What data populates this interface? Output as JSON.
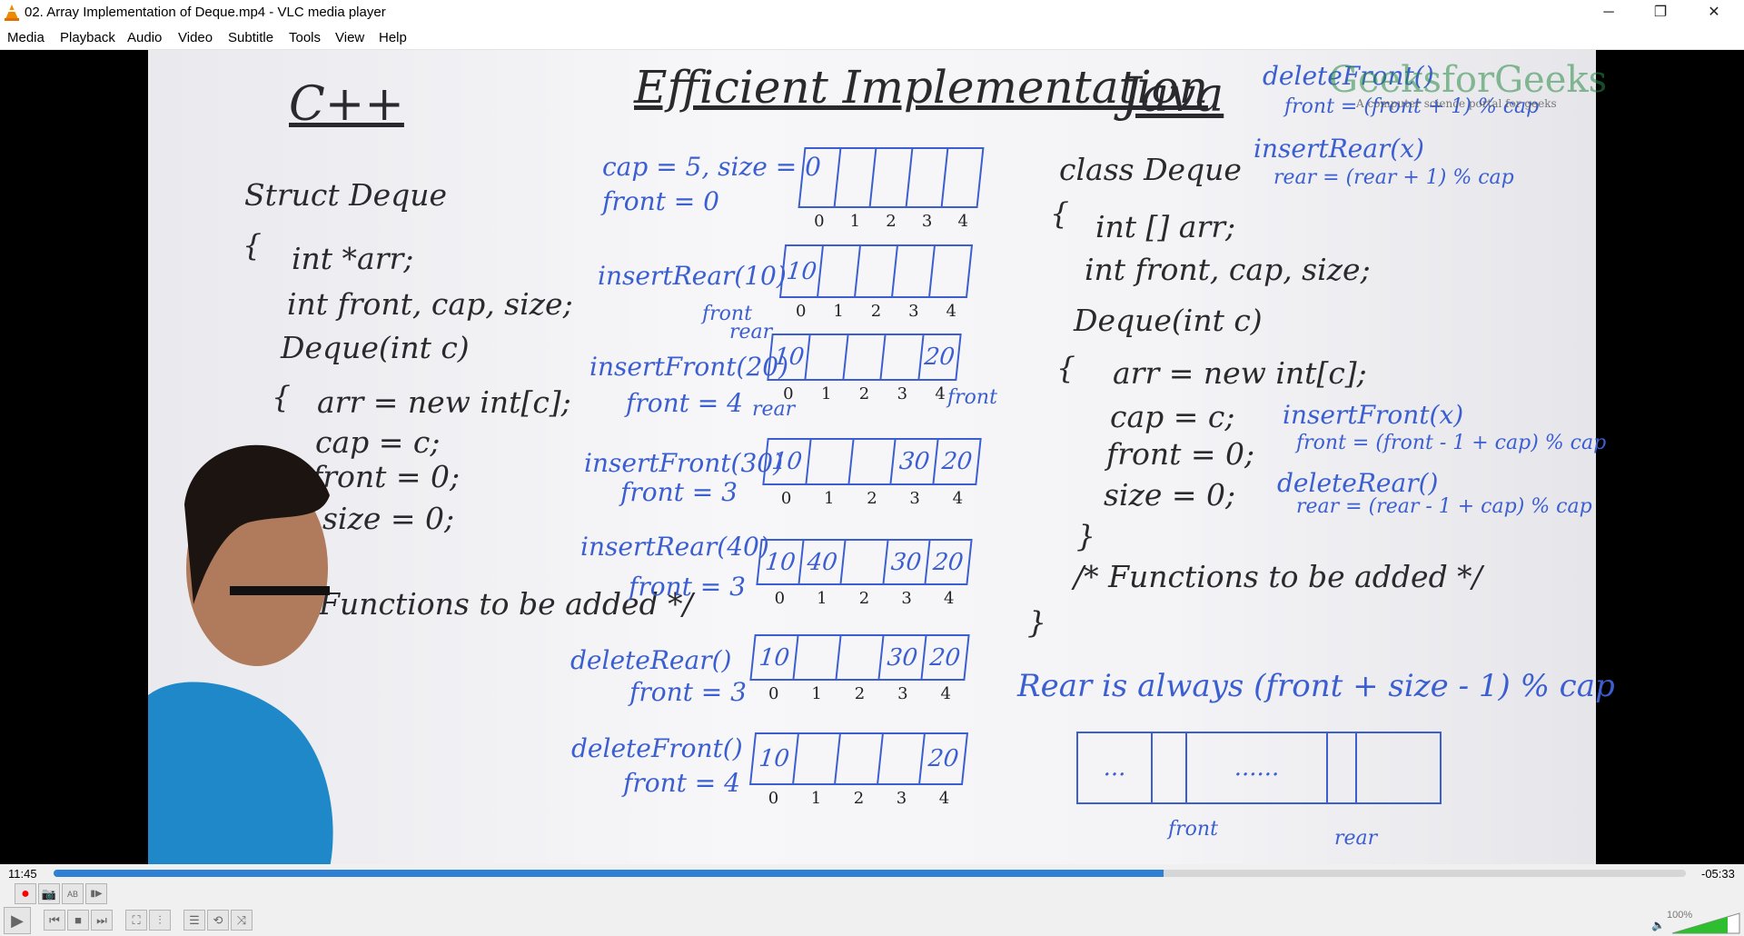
{
  "window": {
    "title": "02. Array Implementation of Deque.mp4 - VLC media player",
    "minimize": "─",
    "maximize": "❐",
    "close": "✕"
  },
  "menu": [
    "Media",
    "Playback",
    "Audio",
    "Video",
    "Subtitle",
    "Tools",
    "View",
    "Help"
  ],
  "board": {
    "cpp": {
      "heading": "C++",
      "lines": [
        "Struct Deque",
        "{",
        "int *arr;",
        "int front, cap, size;",
        "Deque(int c)",
        "{",
        "arr = new int[c];",
        "cap = c;",
        "front = 0;",
        "size = 0;",
        "/* Functions to be added */"
      ]
    },
    "center": {
      "heading": "Efficient Implementation",
      "init": [
        "cap = 5, size = 0",
        "front = 0"
      ],
      "steps": [
        {
          "label": "",
          "sub": "",
          "cells": [
            "",
            "",
            "",
            "",
            ""
          ]
        },
        {
          "label": "insertRear(10)",
          "sub": "",
          "cells": [
            "10",
            "",
            "",
            "",
            ""
          ],
          "notes": [
            "front",
            "rear"
          ]
        },
        {
          "label": "insertFront(20)",
          "sub": "front = 4",
          "cells": [
            "10",
            "",
            "",
            "",
            "20"
          ],
          "notes": [
            "rear",
            "front"
          ]
        },
        {
          "label": "insertFront(30)",
          "sub": "front = 3",
          "cells": [
            "10",
            "",
            "",
            "30",
            "20"
          ]
        },
        {
          "label": "insertRear(40)",
          "sub": "front = 3",
          "cells": [
            "10",
            "40",
            "",
            "30",
            "20"
          ]
        },
        {
          "label": "deleteRear()",
          "sub": "front = 3",
          "cells": [
            "10",
            "",
            "",
            "30",
            "20"
          ]
        },
        {
          "label": "deleteFront()",
          "sub": "front = 4",
          "cells": [
            "10",
            "",
            "",
            "",
            "20"
          ]
        }
      ],
      "indices": [
        "0",
        "1",
        "2",
        "3",
        "4"
      ]
    },
    "java": {
      "heading": "Java",
      "lines": [
        "class Deque",
        "{",
        "int [] arr;",
        "int front, cap, size;",
        "Deque(int c)",
        "{",
        "arr = new int[c];",
        "cap = c;",
        "front = 0;",
        "size = 0;",
        "}",
        "/* Functions to be added */",
        "}"
      ]
    },
    "notes": [
      "deleteFront()",
      "front = (front + 1) % cap",
      "insertRear(x)",
      "rear = (rear + 1) % cap",
      "insertFront(x)",
      "front = (front - 1 + cap) % cap",
      "deleteRear()",
      "rear = (rear - 1 + cap) % cap"
    ],
    "rear_formula": "Rear is always (front + size - 1) % cap",
    "diagram": {
      "cells": [
        "...",
        "",
        "......",
        "",
        ""
      ],
      "front": "front",
      "rear": "rear"
    },
    "watermark": {
      "brand": "GeeksforGeeks",
      "tagline": "A computer science portal for geeks"
    }
  },
  "player": {
    "elapsed": "11:45",
    "remaining": "-05:33",
    "progress": 0.68,
    "volume_label": "100%",
    "volume": 1.0,
    "accent": "#2f7fd4",
    "buttons": {
      "record": "●",
      "snapshot": "📷",
      "loop_ab": "AB",
      "frame": "▮▶",
      "play": "▶",
      "prev": "⏮",
      "stop": "■",
      "next": "⏭",
      "fullscreen": "⛶",
      "extended": "⫶",
      "playlist": "☰",
      "loop": "⟲",
      "shuffle": "⤨",
      "speaker": "🔈"
    }
  }
}
